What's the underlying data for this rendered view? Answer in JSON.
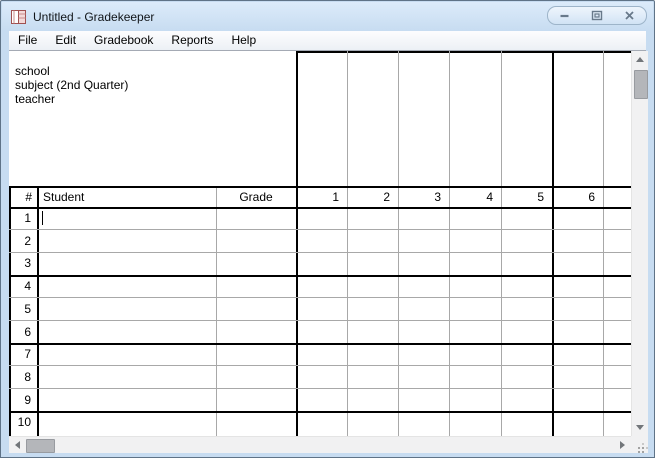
{
  "window": {
    "title": "Untitled - Gradekeeper"
  },
  "menu": {
    "items": [
      "File",
      "Edit",
      "Gradebook",
      "Reports",
      "Help"
    ]
  },
  "header_info": {
    "school": "school",
    "subject": "subject (2nd Quarter)",
    "teacher": "teacher"
  },
  "table": {
    "corner_header": "#",
    "student_header": "Student",
    "grade_header": "Grade",
    "assignment_headers": [
      "1",
      "2",
      "3",
      "4",
      "5",
      "6"
    ],
    "row_numbers": [
      "1",
      "2",
      "3",
      "4",
      "5",
      "6",
      "7",
      "8",
      "9",
      "10"
    ]
  },
  "icons": {
    "app": "gradebook-icon",
    "minimize": "minimize-icon",
    "maximize": "maximize-icon",
    "close": "close-icon",
    "scroll_up": "arrow-up-icon",
    "scroll_down": "arrow-down-icon",
    "scroll_left": "arrow-left-icon",
    "scroll_right": "arrow-right-icon",
    "resize_grip": "size-grip-icon"
  },
  "colors": {
    "titlebar": "#cfe2f5",
    "window_border": "#c7dcf1",
    "grid_line_major": "#000000",
    "grid_line_minor": "#a8a8a8",
    "scrollbar_track": "#f1f1f2",
    "scrollbar_thumb": "#b4b6ba"
  }
}
